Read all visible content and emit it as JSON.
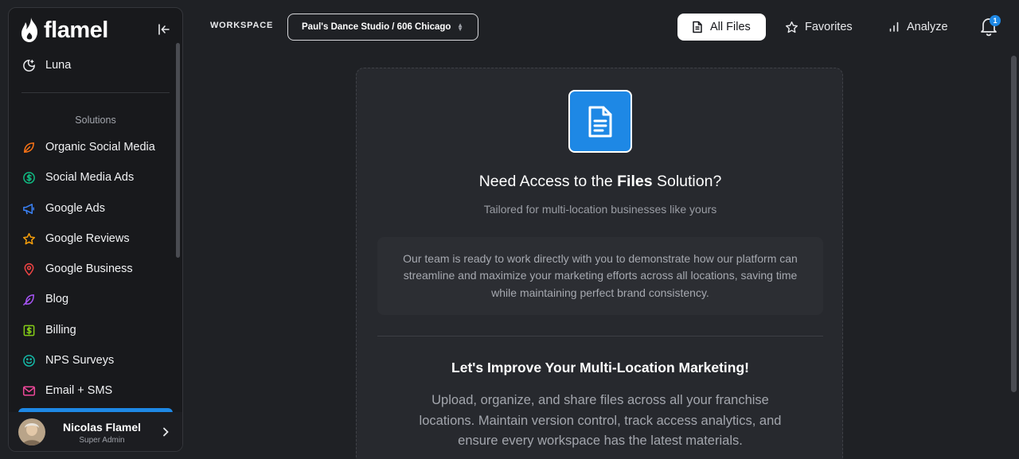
{
  "brand": {
    "name": "flamel"
  },
  "sidebar": {
    "top_item": {
      "label": "Luna",
      "icon": "moon-star-icon",
      "color": "#e8e9ec"
    },
    "section_label": "Solutions",
    "items": [
      {
        "label": "Organic Social Media",
        "icon": "leaf-icon",
        "color": "#f97316"
      },
      {
        "label": "Social Media Ads",
        "icon": "dollar-circle-icon",
        "color": "#10b981"
      },
      {
        "label": "Google Ads",
        "icon": "megaphone-icon",
        "color": "#3b82f6"
      },
      {
        "label": "Google Reviews",
        "icon": "star-icon",
        "color": "#f59e0b"
      },
      {
        "label": "Google Business",
        "icon": "map-pin-icon",
        "color": "#ef4444"
      },
      {
        "label": "Blog",
        "icon": "feather-icon",
        "color": "#a855f7"
      },
      {
        "label": "Billing",
        "icon": "dollar-square-icon",
        "color": "#84cc16"
      },
      {
        "label": "NPS Surveys",
        "icon": "smile-icon",
        "color": "#14b8a6"
      },
      {
        "label": "Email + SMS",
        "icon": "mail-icon",
        "color": "#ec4899"
      }
    ],
    "user": {
      "name": "Nicolas Flamel",
      "role": "Super Admin"
    }
  },
  "header": {
    "workspace_label": "WORKSPACE",
    "workspace_value": "Paul's Dance Studio / 606 Chicago",
    "nav": {
      "all_files": "All Files",
      "favorites": "Favorites",
      "analyze": "Analyze"
    },
    "notification_count": "1"
  },
  "main": {
    "headline_pre": "Need Access to the ",
    "headline_bold": "Files",
    "headline_post": " Solution?",
    "subline": "Tailored for multi-location businesses like yours",
    "info_text": "Our team is ready to work directly with you to demonstrate how our platform can streamline and maximize your marketing efforts across all locations, saving time while maintaining perfect brand consistency.",
    "cta_title": "Let's Improve Your Multi-Location Marketing!",
    "cta_body": "Upload, organize, and share files across all your franchise locations. Maintain version control, track access analytics, and ensure every workspace has the latest materials."
  },
  "colors": {
    "accent": "#1e88e5",
    "background": "#1f2125",
    "card": "#27292e"
  }
}
